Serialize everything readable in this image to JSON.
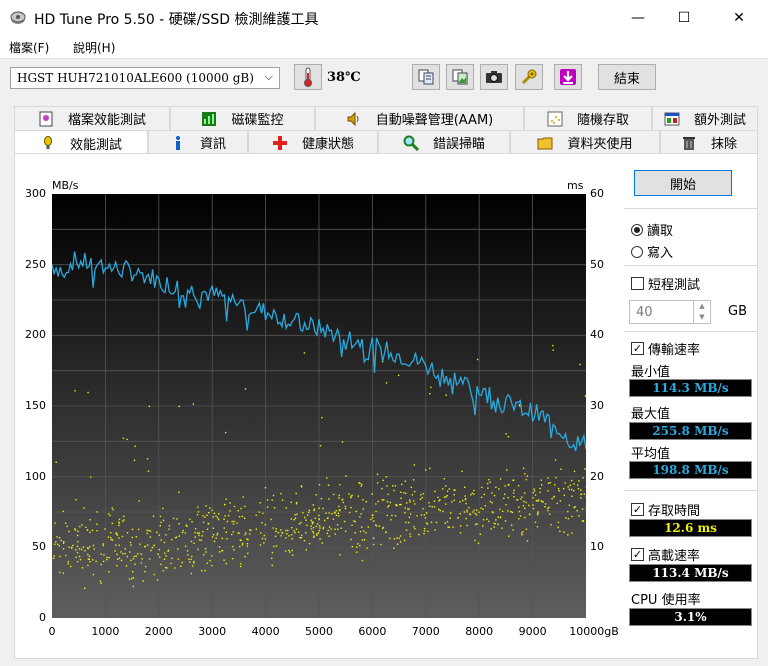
{
  "window": {
    "title": "HD Tune Pro 5.50 - 硬碟/SSD 檢測維護工具",
    "minimize_glyph": "—",
    "maximize_glyph": "☐",
    "close_glyph": "✕"
  },
  "menu": [
    "檔案(F)",
    "說明(H)"
  ],
  "toolbar": {
    "drive": "HGST HUH721010ALE600 (10000 gB)",
    "dropdown_arrow": "⌵",
    "temperature": "38℃",
    "exit_label": "結束"
  },
  "tabs_top": [
    {
      "label": "檔案效能測試",
      "icon": "file-benchmark-icon"
    },
    {
      "label": "磁碟監控",
      "icon": "disk-monitor-icon"
    },
    {
      "label": "自動噪聲管理(AAM)",
      "icon": "speaker-icon"
    },
    {
      "label": "隨機存取",
      "icon": "random-access-icon"
    },
    {
      "label": "額外測試",
      "icon": "extra-tests-icon"
    }
  ],
  "tabs_bottom": [
    {
      "label": "效能測試",
      "icon": "benchmark-icon",
      "active": true
    },
    {
      "label": "資訊",
      "icon": "info-icon"
    },
    {
      "label": "健康狀態",
      "icon": "health-icon"
    },
    {
      "label": "錯誤掃瞄",
      "icon": "error-scan-icon"
    },
    {
      "label": "資料夾使用",
      "icon": "folder-usage-icon"
    },
    {
      "label": "抹除",
      "icon": "erase-icon"
    }
  ],
  "controls": {
    "start_label": "開始",
    "read_label": "讀取",
    "write_label": "寫入",
    "short_test_label": "短程測試",
    "short_test_value": "40",
    "short_test_unit": "GB",
    "transfer_rate_label": "傳輸速率",
    "min_label": "最小值",
    "min_value": "114.3 MB/s",
    "max_label": "最大值",
    "max_value": "255.8 MB/s",
    "avg_label": "平均值",
    "avg_value": "198.8 MB/s",
    "access_time_label": "存取時間",
    "access_time_value": "12.6 ms",
    "burst_label": "高載速率",
    "burst_value": "113.4 MB/s",
    "cpu_label": "CPU 使用率",
    "cpu_value": "3.1%",
    "colors": {
      "transfer": "#2aa9de",
      "access": "#f0f000",
      "min": "#2aa9de",
      "max": "#2aa9de",
      "avg": "#2aa9de",
      "access_box": "#f0f000",
      "burst": "#ffffff",
      "cpu": "#ffffff"
    }
  },
  "chart_data": {
    "type": "line",
    "left_unit": "MB/s",
    "right_unit": "ms",
    "y_left_ticks": [
      "300",
      "250",
      "200",
      "150",
      "100",
      "50",
      "0"
    ],
    "y_right_ticks": [
      "60",
      "50",
      "40",
      "30",
      "20",
      "10"
    ],
    "x_ticks": [
      "0",
      "1000",
      "2000",
      "3000",
      "4000",
      "5000",
      "6000",
      "7000",
      "8000",
      "9000",
      "10000gB"
    ],
    "xlim": [
      0,
      10000
    ],
    "ylim_left": [
      0,
      300
    ],
    "ylim_right": [
      0,
      60
    ],
    "grid": true,
    "series": [
      {
        "axis": "left",
        "color": "#2aa9de",
        "x": [
          0,
          100,
          200,
          300,
          400,
          500,
          700,
          900,
          1000,
          1100,
          1200,
          1400,
          1500,
          1700,
          1900,
          2000,
          2200,
          2400,
          2600,
          2800,
          3000,
          3300,
          3600,
          3900,
          4200,
          4500,
          4800,
          5100,
          5400,
          5700,
          6000,
          6300,
          6600,
          6900,
          7200,
          7500,
          7800,
          8100,
          8400,
          8700,
          9000,
          9300,
          9600,
          9800,
          10000
        ],
        "y": [
          250,
          248,
          246,
          249,
          253,
          252,
          251,
          250,
          249,
          248,
          247,
          246,
          245,
          243,
          241,
          238,
          236,
          234,
          232,
          231,
          229,
          226,
          222,
          218,
          214,
          210,
          207,
          204,
          200,
          197,
          192,
          189,
          185,
          181,
          175,
          170,
          165,
          160,
          154,
          149,
          146,
          140,
          131,
          124,
          123
        ]
      },
      {
        "axis": "right",
        "color": "#f0f000",
        "mode": "scatter",
        "mean_trend_x": [
          0,
          2000,
          4000,
          6000,
          8000,
          10000
        ],
        "mean_trend_y": [
          10,
          11,
          13,
          15,
          16,
          17
        ]
      }
    ]
  }
}
